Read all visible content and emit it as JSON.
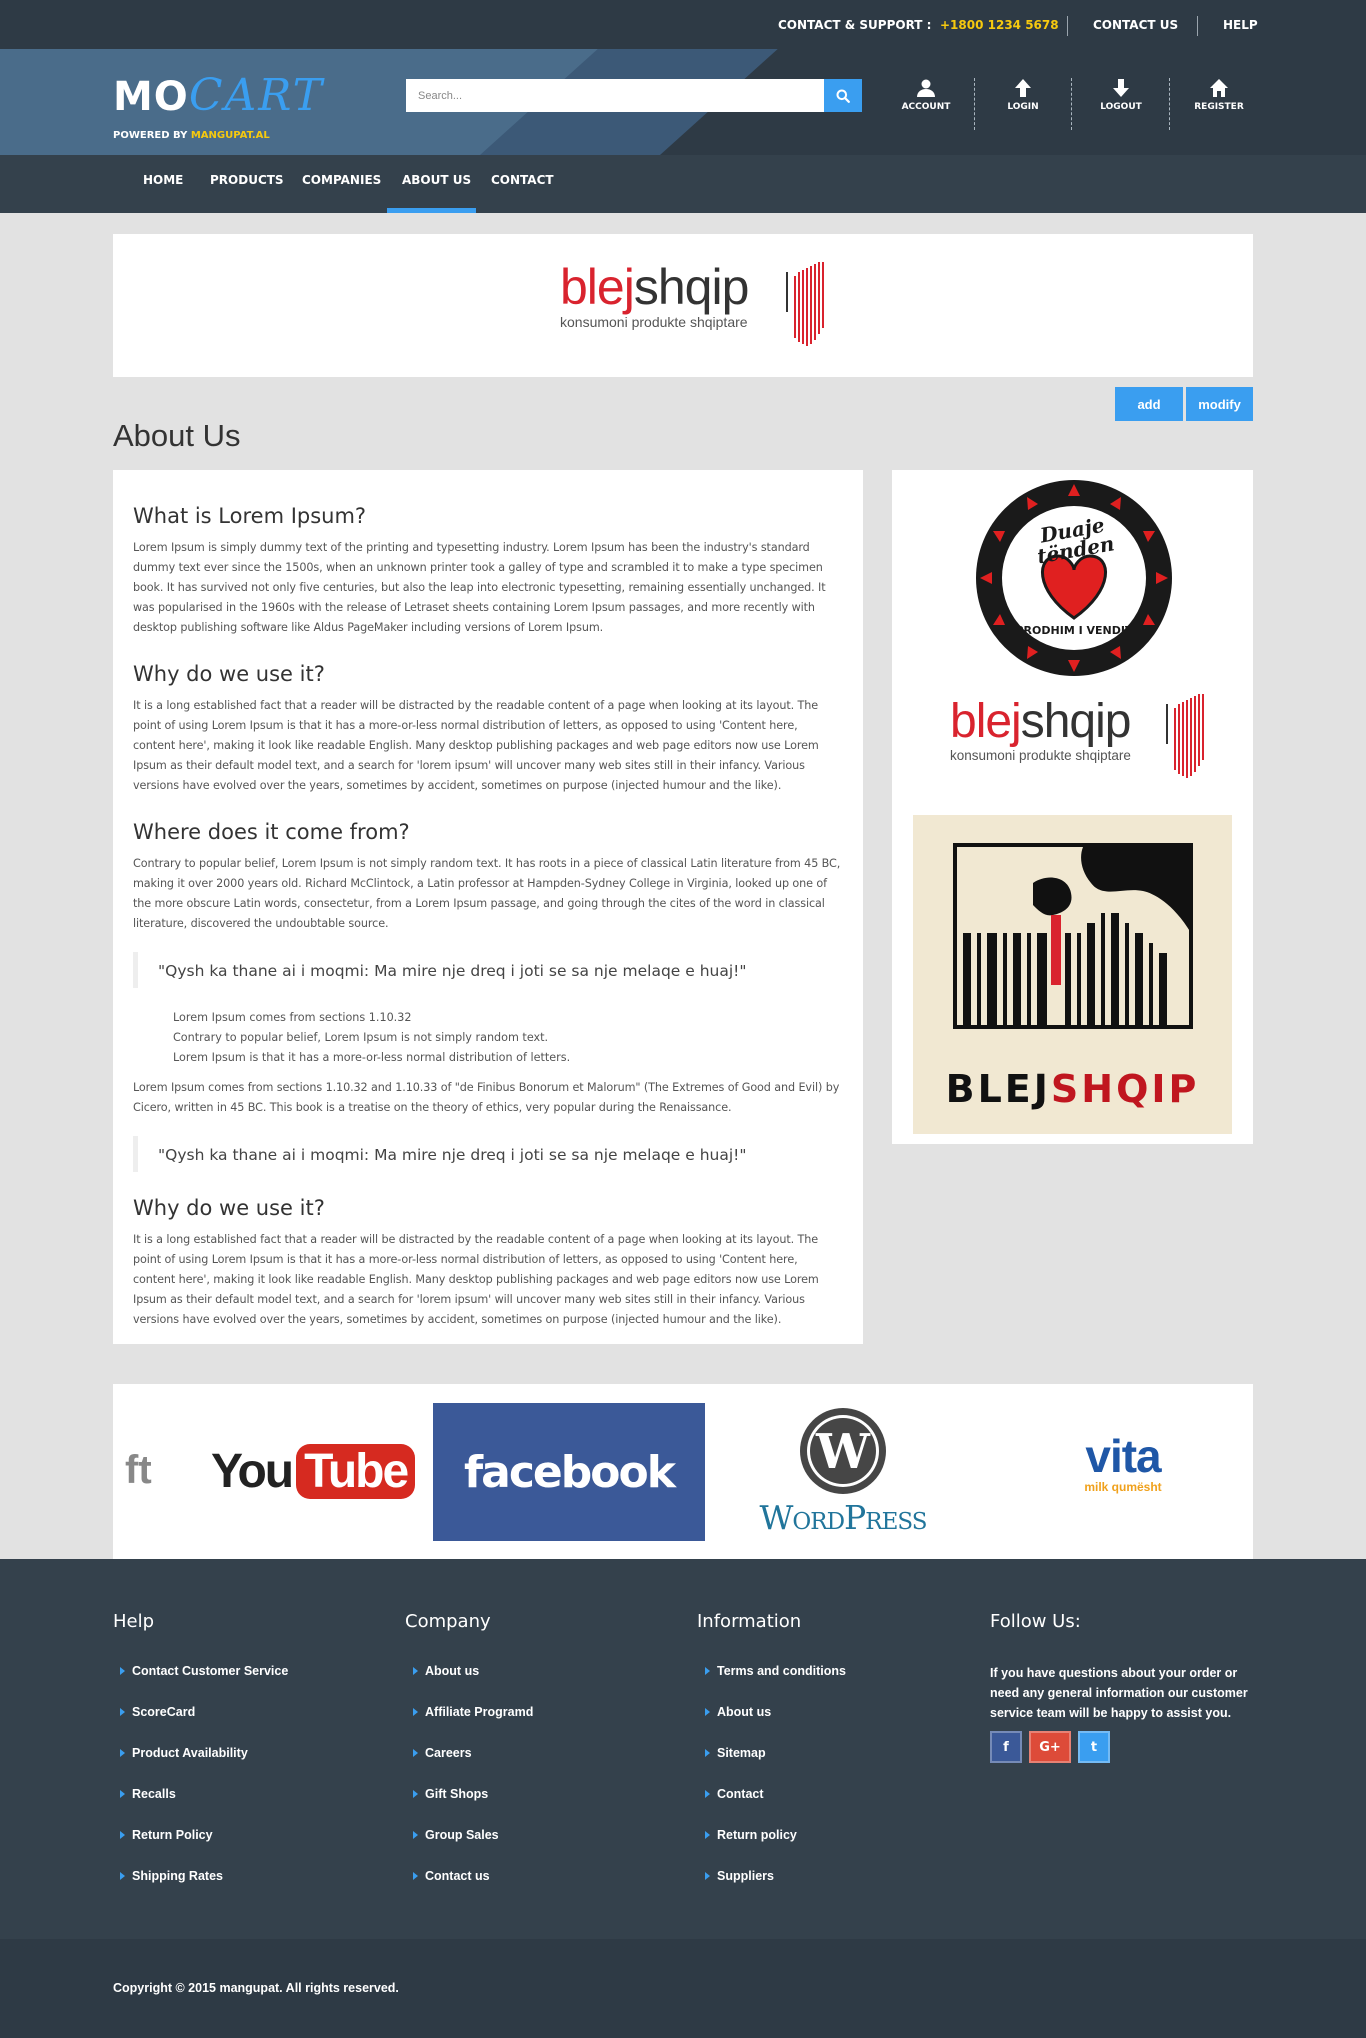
{
  "topbar": {
    "support_label": "CONTACT & SUPPORT :",
    "phone": "+1800 1234 5678",
    "contact_us": "CONTACT US",
    "help": "HELP"
  },
  "header": {
    "logo_mo": "MO",
    "logo_cart": "CART",
    "powered_by": "POWERED BY",
    "powered_site": "MANGUPAT.AL",
    "search_placeholder": "Search...",
    "icons": {
      "account": "ACCOUNT",
      "login": "LOGIN",
      "logout": "LOGOUT",
      "register": "REGISTER"
    }
  },
  "nav": {
    "home": "HOME",
    "products": "PRODUCTS",
    "companies": "COMPANIES",
    "about": "ABOUT US",
    "contact": "CONTACT",
    "active": "ABOUT US"
  },
  "banner": {
    "brand_blej": "blej",
    "brand_shqip": "shqip",
    "tagline": "konsumoni produkte shqiptare"
  },
  "actions": {
    "add": "add",
    "modify": "modify"
  },
  "page_title": "About Us",
  "content": {
    "s1_title": "What is Lorem Ipsum?",
    "s1_text": "Lorem Ipsum is simply dummy text of the printing and typesetting industry. Lorem Ipsum has been the industry's standard dummy text ever since the 1500s, when an unknown printer took a galley of type and scrambled it to make a type specimen book. It has survived not only five centuries, but also the leap into electronic typesetting, remaining essentially unchanged. It was popularised in the 1960s with the release of Letraset sheets containing Lorem Ipsum passages, and more recently with desktop publishing software like Aldus PageMaker including versions of Lorem Ipsum.",
    "s2_title": "Why do we use it?",
    "s2_text": "It is a long established fact that a reader will be distracted by the readable content of a page when looking at its layout. The point of using Lorem Ipsum is that it has a more-or-less normal distribution of letters, as opposed to using 'Content here, content here', making it look like readable English. Many desktop publishing packages and web page editors now use Lorem Ipsum as their default model text, and a search for 'lorem ipsum' will uncover many web sites still in their infancy. Various versions have evolved over the years, sometimes by accident, sometimes on purpose (injected humour and the like).",
    "s3_title": "Where does it come from?",
    "s3_text": "Contrary to popular belief, Lorem Ipsum is not simply random text. It has roots in a piece of classical Latin literature from 45 BC, making it over 2000 years old. Richard McClintock, a Latin professor at Hampden-Sydney College in Virginia, looked up one of the more obscure Latin words, consectetur, from a Lorem Ipsum passage, and going through the cites of the word in classical literature, discovered the undoubtable source.",
    "quote1": "\"Qysh ka thane ai i moqmi: Ma mire nje dreq i joti se sa nje melaqe e huaj!\"",
    "list": [
      "Lorem Ipsum comes from sections 1.10.32",
      "Contrary to popular belief, Lorem Ipsum is not simply random text.",
      "Lorem Ipsum is that it has a more-or-less normal distribution of letters."
    ],
    "s3_text2": "Lorem Ipsum comes from sections 1.10.32 and 1.10.33 of \"de Finibus Bonorum et Malorum\" (The Extremes of Good and Evil) by Cicero, written in 45 BC. This book is a treatise on the theory of ethics, very popular during the Renaissance.",
    "quote2": "\"Qysh ka thane ai i moqmi: Ma mire nje dreq i joti se sa nje melaqe e huaj!\"",
    "s4_title": "Why do we use it?",
    "s4_text": "It is a long established fact that a reader will be distracted by the readable content of a page when looking at its layout. The point of using Lorem Ipsum is that it has a more-or-less normal distribution of letters, as opposed to using 'Content here, content here', making it look like readable English. Many desktop publishing packages and web page editors now use Lorem Ipsum as their default model text, and a search for 'lorem ipsum' will uncover many web sites still in their infancy. Various versions have evolved over the years, sometimes by accident, sometimes on purpose (injected humour and the like)."
  },
  "sidebar": {
    "badge_word1": "Duaje",
    "badge_word2": "tënden",
    "badge_bottom": "PRODHIM I VENDIT",
    "brand_blej": "blej",
    "brand_shqip": "shqip",
    "tagline": "konsumoni produkte shqiptare",
    "poster_blej": "BLEJ",
    "poster_shqip": "SHQIP"
  },
  "partners": {
    "partial": "ft",
    "youtube_you": "You",
    "youtube_tube": "Tube",
    "facebook": "facebook",
    "wordpress": "WordPress",
    "vita": "vita",
    "vita_sub": "milk qumësht"
  },
  "footer": {
    "help_title": "Help",
    "help_links": [
      "Contact Customer Service",
      "ScoreCard",
      "Product Availability",
      "Recalls",
      "Return Policy",
      "Shipping Rates"
    ],
    "company_title": "Company",
    "company_links": [
      "About us",
      "Affiliate Programd",
      "Careers",
      "Gift Shops",
      "Group Sales",
      "Contact us"
    ],
    "info_title": "Information",
    "info_links": [
      "Terms and conditions",
      "About us",
      "Sitemap",
      "Contact",
      "Return policy",
      "Suppliers"
    ],
    "follow_title": "Follow Us:",
    "follow_text": "If you have questions about your order or need any general information our customer service team will be happy to assist you.",
    "social": {
      "facebook": "f",
      "google": "G+",
      "twitter": "t"
    },
    "copyright": "Copyright © 2015 mangupat. All rights reserved."
  },
  "colors": {
    "accent": "#3a9ef0",
    "topbar": "#2e3a45",
    "header": "#4a6c8a",
    "nav": "#34414c",
    "phone": "#f6c90e"
  }
}
